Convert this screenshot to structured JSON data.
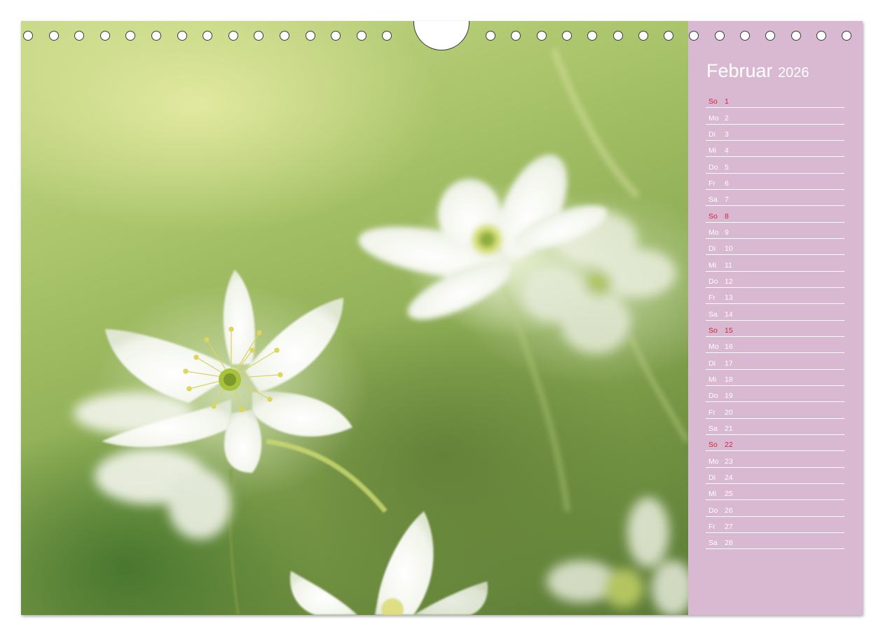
{
  "calendar": {
    "month": "Februar",
    "year": "2026",
    "days": [
      {
        "wd": "So",
        "num": "1",
        "sunday": true
      },
      {
        "wd": "Mo",
        "num": "2"
      },
      {
        "wd": "Di",
        "num": "3"
      },
      {
        "wd": "Mi",
        "num": "4"
      },
      {
        "wd": "Do",
        "num": "5"
      },
      {
        "wd": "Fr",
        "num": "6"
      },
      {
        "wd": "Sa",
        "num": "7"
      },
      {
        "wd": "So",
        "num": "8",
        "sunday": true
      },
      {
        "wd": "Mo",
        "num": "9"
      },
      {
        "wd": "Di",
        "num": "10"
      },
      {
        "wd": "Mi",
        "num": "11"
      },
      {
        "wd": "Do",
        "num": "12"
      },
      {
        "wd": "Fr",
        "num": "13"
      },
      {
        "wd": "Sa",
        "num": "14"
      },
      {
        "wd": "So",
        "num": "15",
        "sunday": true
      },
      {
        "wd": "Mo",
        "num": "16"
      },
      {
        "wd": "Di",
        "num": "17"
      },
      {
        "wd": "Mi",
        "num": "18"
      },
      {
        "wd": "Do",
        "num": "19"
      },
      {
        "wd": "Fr",
        "num": "20"
      },
      {
        "wd": "Sa",
        "num": "21"
      },
      {
        "wd": "So",
        "num": "22",
        "sunday": true
      },
      {
        "wd": "Mo",
        "num": "23"
      },
      {
        "wd": "Di",
        "num": "24"
      },
      {
        "wd": "Mi",
        "num": "25"
      },
      {
        "wd": "Do",
        "num": "26"
      },
      {
        "wd": "Fr",
        "num": "27"
      },
      {
        "wd": "Sa",
        "num": "28"
      }
    ]
  },
  "colors": {
    "sidebar": "#d9b8d2",
    "sunday_text": "#d2233b",
    "weekday_text": "#ffffff"
  },
  "photo": {
    "subject": "white wood anemone flowers"
  }
}
